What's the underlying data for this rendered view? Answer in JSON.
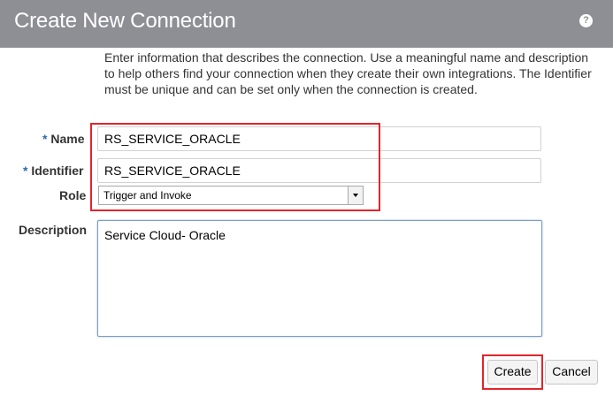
{
  "dialog": {
    "title": "Create New Connection",
    "help_icon_glyph": "?",
    "instructions": "Enter information that describes the connection. Use a meaningful name and description to help others find your connection when they create their own integrations. The Identifier must be unique and can be set only when the connection is created."
  },
  "form": {
    "required_marker": "*",
    "name_label": "Name",
    "name_value": "RS_SERVICE_ORACLE",
    "identifier_label": "Identifier",
    "identifier_value": "RS_SERVICE_ORACLE",
    "role_label": "Role",
    "role_value": "Trigger and Invoke",
    "description_label": "Description",
    "description_value": "Service Cloud- Oracle"
  },
  "buttons": {
    "create": "Create",
    "cancel": "Cancel"
  },
  "colors": {
    "header_bg": "#8e8f95",
    "highlight": "#e3242b",
    "required": "#2f6bb1"
  }
}
